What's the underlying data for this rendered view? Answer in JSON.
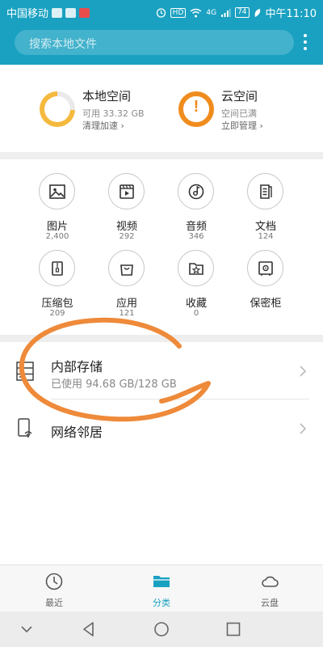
{
  "status_bar": {
    "carrier": "中国移动",
    "battery": "74",
    "network": "4G",
    "time": "中午11:10"
  },
  "search": {
    "placeholder": "搜索本地文件"
  },
  "storage": {
    "local": {
      "title": "本地空间",
      "available": "可用 33.32 GB",
      "action": "清理加速",
      "used_fraction": 0.74
    },
    "cloud": {
      "title": "云空间",
      "status": "空间已满",
      "action": "立即管理"
    }
  },
  "categories": [
    {
      "label": "图片",
      "count": "2,400",
      "icon": "image-icon"
    },
    {
      "label": "视频",
      "count": "292",
      "icon": "video-icon"
    },
    {
      "label": "音频",
      "count": "346",
      "icon": "music-icon"
    },
    {
      "label": "文档",
      "count": "124",
      "icon": "document-icon"
    },
    {
      "label": "压缩包",
      "count": "209",
      "icon": "archive-icon"
    },
    {
      "label": "应用",
      "count": "121",
      "icon": "shopping-bag-icon"
    },
    {
      "label": "收藏",
      "count": "0",
      "icon": "star-folder-icon"
    },
    {
      "label": "保密柜",
      "count": "",
      "icon": "safe-icon"
    }
  ],
  "list": {
    "internal": {
      "title": "内部存储",
      "subtitle": "已使用 94.68 GB/128 GB"
    },
    "network": {
      "title": "网络邻居"
    }
  },
  "bottom_nav": [
    {
      "label": "最近",
      "icon": "clock-icon",
      "active": false
    },
    {
      "label": "分类",
      "icon": "folder-icon",
      "active": true
    },
    {
      "label": "云盘",
      "icon": "cloud-icon",
      "active": false
    }
  ],
  "colors": {
    "accent": "#1aa1c1",
    "local_ring": "#f5b93d",
    "cloud_ring": "#f08c1e",
    "annotation": "#ee8a3a"
  }
}
